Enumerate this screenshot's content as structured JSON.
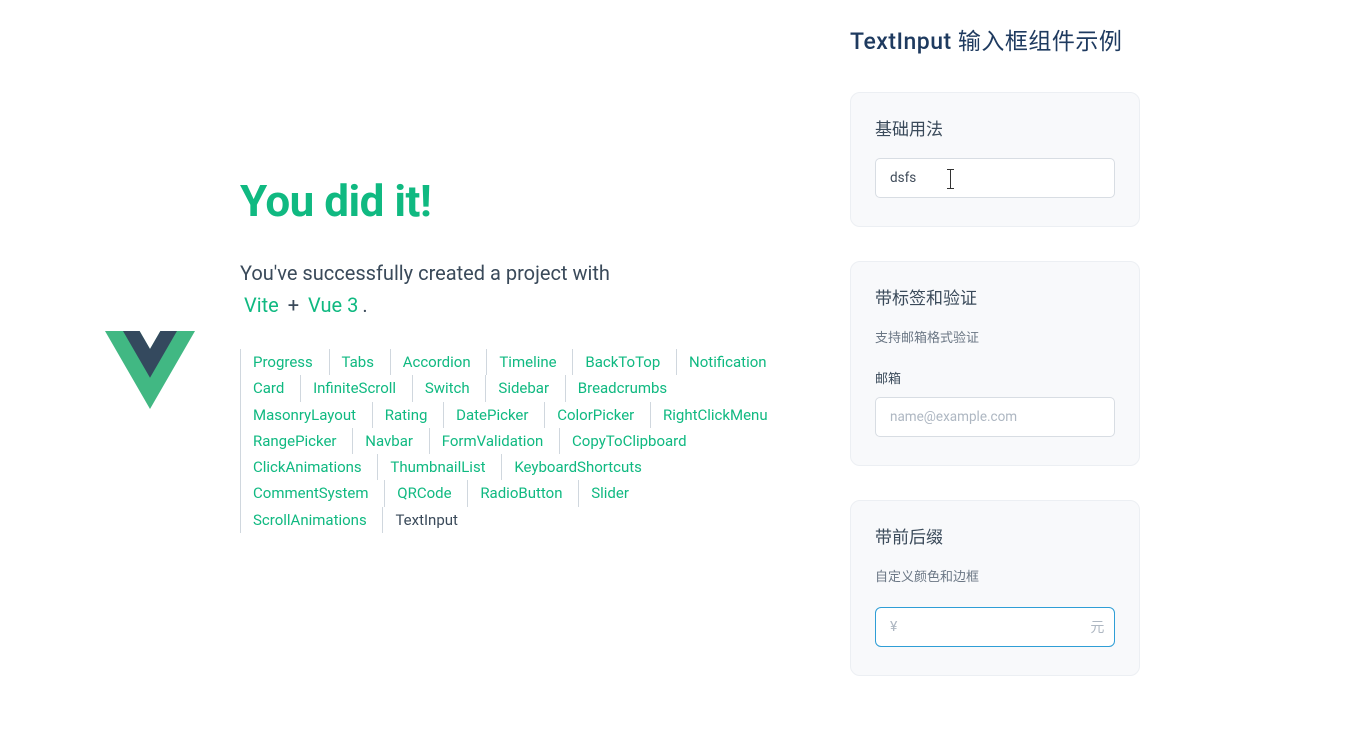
{
  "left": {
    "title": "You did it!",
    "subtitle_pre": "You've successfully created a project with",
    "vite": "Vite",
    "plus": "+",
    "vue": "Vue 3",
    "period": "."
  },
  "nav": [
    "Progress",
    "Tabs",
    "Accordion",
    "Timeline",
    "BackToTop",
    "Notification",
    "Card",
    "InfiniteScroll",
    "Switch",
    "Sidebar",
    "Breadcrumbs",
    "MasonryLayout",
    "Rating",
    "DatePicker",
    "ColorPicker",
    "RightClickMenu",
    "RangePicker",
    "Navbar",
    "FormValidation",
    "CopyToClipboard",
    "ClickAnimations",
    "ThumbnailList",
    "KeyboardShortcuts",
    "CommentSystem",
    "QRCode",
    "RadioButton",
    "Slider",
    "ScrollAnimations",
    "TextInput"
  ],
  "nav_current": "TextInput",
  "right": {
    "title": "TextInput 输入框组件示例",
    "section1": {
      "title": "基础用法",
      "value": "dsfs"
    },
    "section2": {
      "title": "带标签和验证",
      "subtitle": "支持邮箱格式验证",
      "label": "邮箱",
      "placeholder": "name@example.com"
    },
    "section3": {
      "title": "带前后缀",
      "subtitle": "自定义颜色和边框",
      "prefix": "¥",
      "suffix": "元"
    }
  },
  "colors": {
    "accent": "#10b981",
    "blue_border": "#2f9ed6"
  }
}
